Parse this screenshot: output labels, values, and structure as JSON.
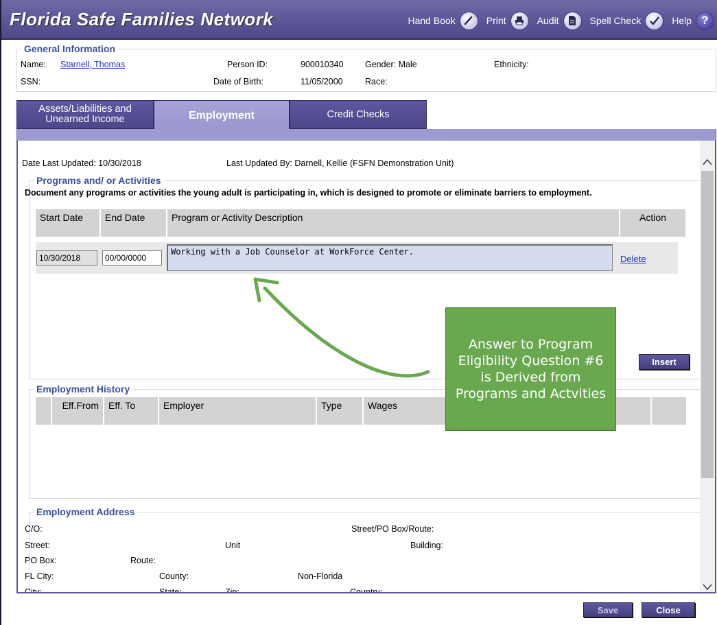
{
  "app": {
    "title": "Florida Safe Families Network"
  },
  "toolbar": {
    "handbook": "Hand Book",
    "print": "Print",
    "audit": "Audit",
    "spellcheck": "Spell Check",
    "help": "Help",
    "help_glyph": "?"
  },
  "general_info": {
    "legend": "General Information",
    "name_label": "Name:",
    "name_value": "Starnell, Thomas",
    "ssn_label": "SSN:",
    "person_id_label": "Person ID:",
    "person_id_value": "900010340",
    "dob_label": "Date of Birth:",
    "dob_value": "11/05/2000",
    "gender_label": "Gender: Male",
    "race_label": "Race:",
    "ethnicity_label": "Ethnicity:"
  },
  "tabs": {
    "assets_line1": "Assets/Liabilities and",
    "assets_line2": "Unearned Income",
    "employment": "Employment",
    "credit": "Credit Checks"
  },
  "meta": {
    "date_updated": "Date Last Updated: 10/30/2018",
    "updated_by": "Last Updated By: Darnell, Kellie (FSFN Demonstration Unit)"
  },
  "programs": {
    "legend": "Programs and/ or Activities",
    "instructions": "Document any programs or activities the young adult is participating in, which is designed to promote or eliminate barriers to employment.",
    "col_start": "Start Date",
    "col_end": "End Date",
    "col_desc": "Program or Activity Description",
    "col_action": "Action",
    "row": {
      "start": "10/30/2018",
      "end": "00/00/0000",
      "description": "Working with a Job Counselor at WorkForce Center.",
      "action": "Delete"
    },
    "insert_label": "Insert"
  },
  "employment_history": {
    "legend": "Employment History",
    "col_from": "Eff.From",
    "col_to": "Eff. To",
    "col_employer": "Employer",
    "col_type": "Type",
    "col_wages": "Wages"
  },
  "employment_address": {
    "legend": "Employment Address",
    "co": "C/O:",
    "street_po": "Street/PO Box/Route:",
    "street": "Street:",
    "unit": "Unit",
    "building": "Building:",
    "po_box": "PO Box:",
    "route": "Route:",
    "fl_city": "FL City:",
    "county": "County:",
    "non_florida": "Non-Florida",
    "city": "City:",
    "state": "State:",
    "zip": "Zip:",
    "country": "Country:"
  },
  "callout": {
    "text": "Answer to Program Eligibility Question #6 is Derived from Programs and Actvities"
  },
  "footer": {
    "save": "Save",
    "close": "Close"
  },
  "colors": {
    "title_bar": "#5a5496",
    "tab_active": "#9d99d1",
    "legend_blue": "#3a4fa0",
    "callout_green": "#6aa84f"
  }
}
